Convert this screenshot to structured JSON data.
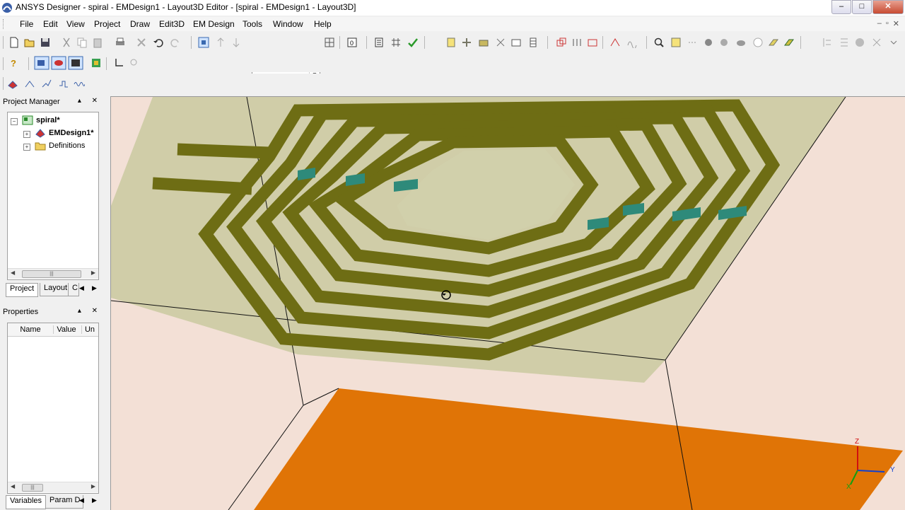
{
  "window": {
    "title": "ANSYS Designer - spiral - EMDesign1 - Layout3D Editor - [spiral - EMDesign1 - Layout3D]",
    "buttons": [
      "–",
      "□",
      "✕"
    ]
  },
  "menus": [
    "File",
    "Edit",
    "View",
    "Project",
    "Draw",
    "Edit3D",
    "EM Design",
    "Tools",
    "Window",
    "Help"
  ],
  "mdi_controls": [
    "–",
    "▫",
    "✕"
  ],
  "toolbar": {
    "combo_value": ""
  },
  "project_manager": {
    "title": "Project Manager",
    "controls": "▴ ✕",
    "tree": [
      {
        "label": "spiral*",
        "bold": true
      },
      {
        "label": "EMDesign1*",
        "bold": true
      },
      {
        "label": "Definitions",
        "bold": false
      }
    ],
    "tabs": [
      "Project",
      "Layout",
      "C"
    ]
  },
  "properties": {
    "title": "Properties",
    "controls": "▴ ✕",
    "columns": [
      "Name",
      "Value",
      "Un"
    ],
    "tabs": [
      "Variables",
      "Param D"
    ]
  },
  "axes": {
    "z": "Z",
    "y": "Y",
    "x": "X"
  },
  "colors": {
    "trace": "#6e6d14",
    "substrate": "#c9c9a0",
    "ground": "#e07406",
    "background": "#f3e0d6",
    "via": "#2e8a7a"
  }
}
